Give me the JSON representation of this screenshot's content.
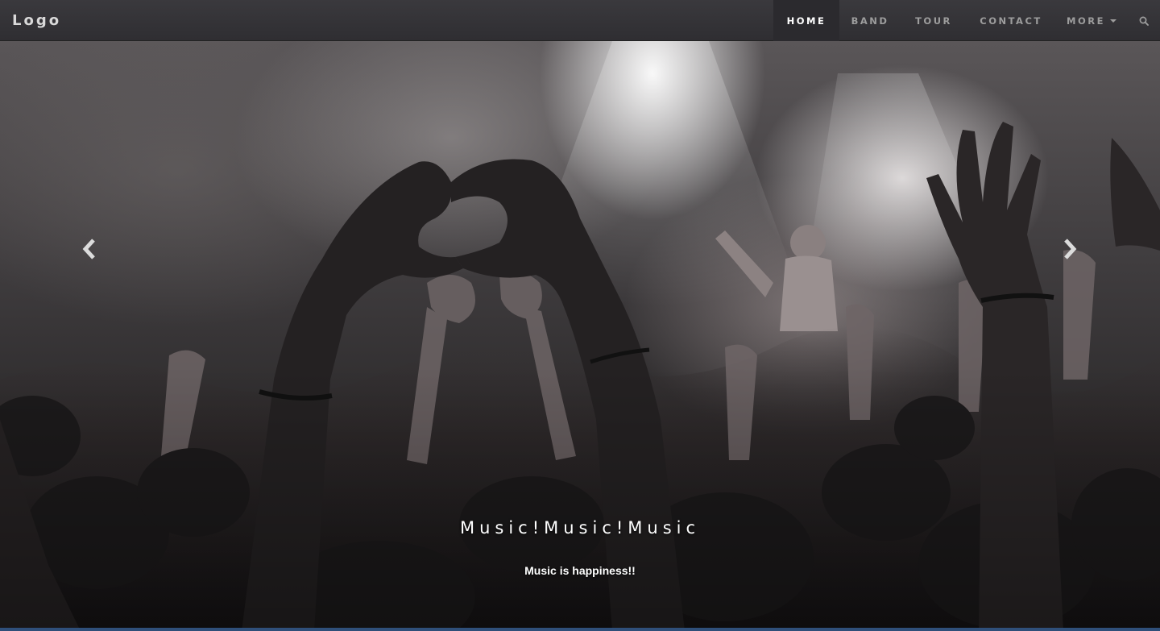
{
  "navbar": {
    "brand": "Logo",
    "items": [
      {
        "label": "HOME",
        "active": true
      },
      {
        "label": "BAND"
      },
      {
        "label": "TOUR"
      },
      {
        "label": "CONTACT"
      },
      {
        "label": "MORE",
        "has_dropdown": true
      }
    ],
    "search_icon": "search-icon"
  },
  "carousel": {
    "prev_icon": "chevron-left-icon",
    "next_icon": "chevron-right-icon",
    "caption_title": "Music!Music!Music",
    "caption_text": "Music is happiness!!"
  },
  "colors": {
    "navbar_bg": "#343337",
    "nav_text": "#9d9d9d",
    "nav_active_text": "#ffffff",
    "caption_text": "#ffffff"
  }
}
